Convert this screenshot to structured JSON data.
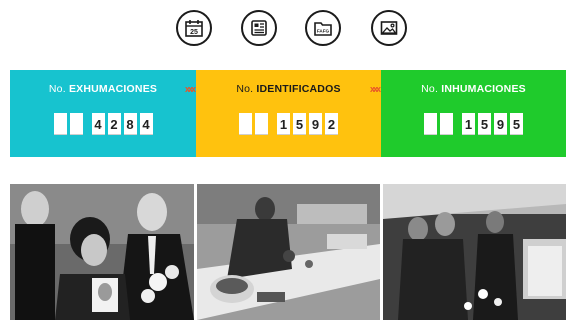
{
  "icons": [
    {
      "name": "calendar-icon",
      "text": "25"
    },
    {
      "name": "document-icon",
      "text": ""
    },
    {
      "name": "folder-icon",
      "text": "FAFG"
    },
    {
      "name": "image-icon",
      "text": ""
    }
  ],
  "stats": [
    {
      "prefix": "No. ",
      "label": "EXHUMACIONES",
      "digits": [
        "",
        "",
        "4",
        "2",
        "8",
        "4"
      ],
      "color": "#17c3cf"
    },
    {
      "prefix": "No. ",
      "label": "IDENTIFICADOS",
      "digits": [
        "",
        "",
        "1",
        "5",
        "9",
        "2"
      ],
      "color": "#ffc20e"
    },
    {
      "prefix": "No. ",
      "label": "INHUMACIONES",
      "digits": [
        "",
        "",
        "1",
        "5",
        "9",
        "5"
      ],
      "color": "#1fcb2c"
    }
  ],
  "separators": [
    "xxx",
    "xxx"
  ],
  "photos": [
    {
      "name": "photo-mourners"
    },
    {
      "name": "photo-lab-table"
    },
    {
      "name": "photo-vigil"
    }
  ]
}
